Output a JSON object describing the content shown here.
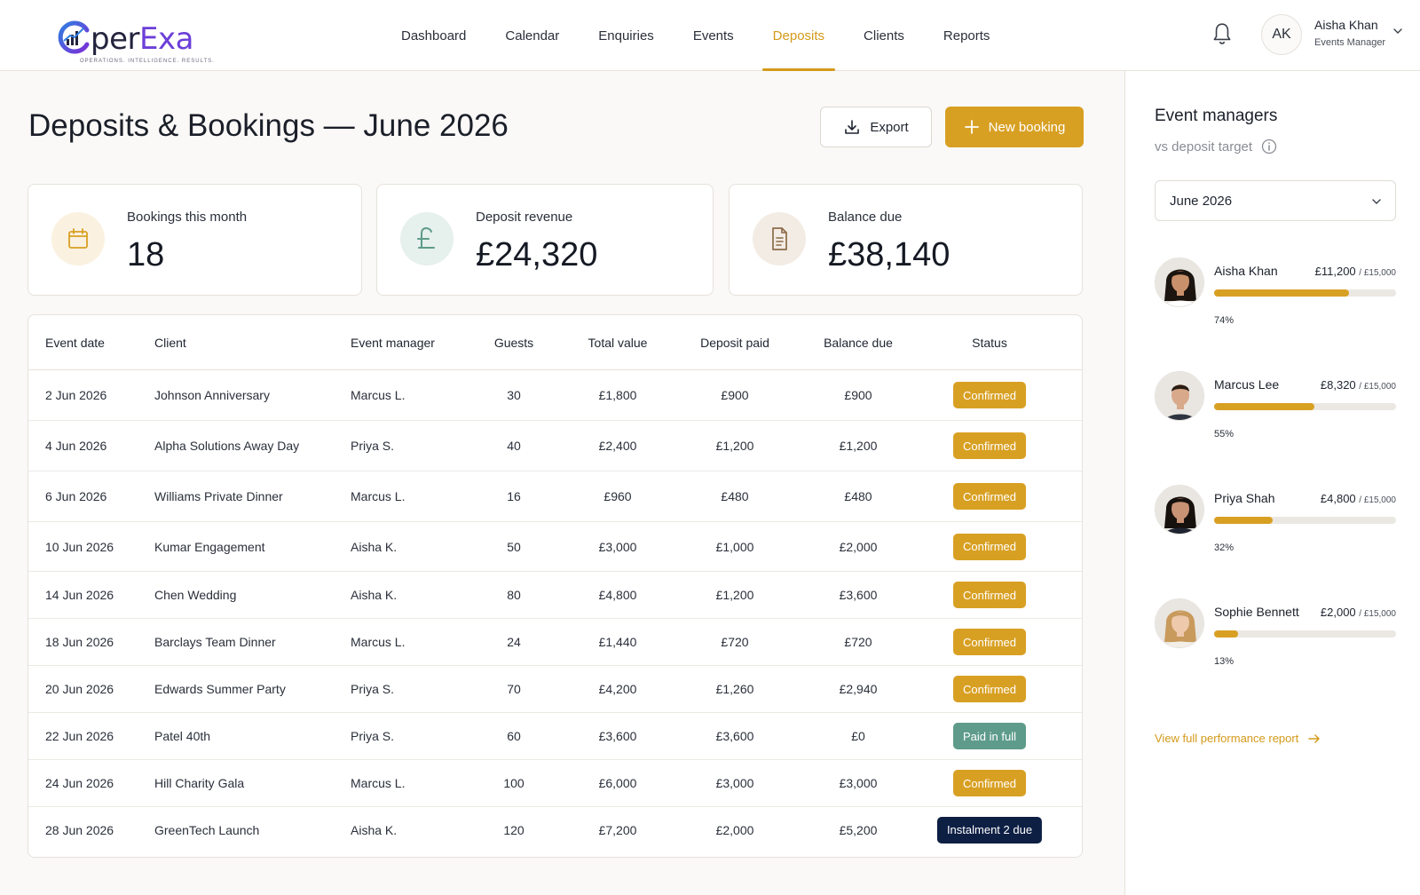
{
  "brand": {
    "name_prefix": "per",
    "name_suffix": "Exa",
    "tagline": "OPERATIONS. INTELLIGENCE. RESULTS.",
    "accent": "#6c3fd8"
  },
  "nav": {
    "items": [
      {
        "label": "Dashboard",
        "active": false
      },
      {
        "label": "Calendar",
        "active": false
      },
      {
        "label": "Enquiries",
        "active": false
      },
      {
        "label": "Events",
        "active": false
      },
      {
        "label": "Deposits",
        "active": true
      },
      {
        "label": "Clients",
        "active": false
      },
      {
        "label": "Reports",
        "active": false
      }
    ]
  },
  "user": {
    "initials": "AK",
    "name": "Aisha Khan",
    "role": "Events Manager"
  },
  "page": {
    "title": "Deposits & Bookings — June 2026",
    "export_label": "Export",
    "new_booking_label": "New booking"
  },
  "stats": [
    {
      "label": "Bookings this month",
      "value": "18",
      "icon": "calendar-icon"
    },
    {
      "label": "Deposit revenue",
      "value": "£24,320",
      "icon": "pound-icon"
    },
    {
      "label": "Balance due",
      "value": "£38,140",
      "icon": "document-icon"
    }
  ],
  "table": {
    "columns": [
      "Event date",
      "Client",
      "Event manager",
      "Guests",
      "Total value",
      "Deposit paid",
      "Balance due",
      "Status"
    ],
    "rows": [
      {
        "date": "2 Jun 2026",
        "client": "Johnson Anniversary",
        "manager": "Marcus L.",
        "guests": "30",
        "total": "£1,800",
        "deposit": "£900",
        "balance": "£900",
        "status": "Confirmed",
        "status_kind": "confirmed"
      },
      {
        "date": "4 Jun 2026",
        "client": "Alpha Solutions Away Day",
        "manager": "Priya S.",
        "guests": "40",
        "total": "£2,400",
        "deposit": "£1,200",
        "balance": "£1,200",
        "status": "Confirmed",
        "status_kind": "confirmed"
      },
      {
        "date": "6 Jun 2026",
        "client": "Williams Private Dinner",
        "manager": "Marcus L.",
        "guests": "16",
        "total": "£960",
        "deposit": "£480",
        "balance": "£480",
        "status": "Confirmed",
        "status_kind": "confirmed"
      },
      {
        "date": "10 Jun 2026",
        "client": "Kumar Engagement",
        "manager": "Aisha K.",
        "guests": "50",
        "total": "£3,000",
        "deposit": "£1,000",
        "balance": "£2,000",
        "status": "Confirmed",
        "status_kind": "confirmed"
      },
      {
        "date": "14 Jun 2026",
        "client": "Chen Wedding",
        "manager": "Aisha K.",
        "guests": "80",
        "total": "£4,800",
        "deposit": "£1,200",
        "balance": "£3,600",
        "status": "Confirmed",
        "status_kind": "confirmed"
      },
      {
        "date": "18 Jun 2026",
        "client": "Barclays Team Dinner",
        "manager": "Marcus L.",
        "guests": "24",
        "total": "£1,440",
        "deposit": "£720",
        "balance": "£720",
        "status": "Confirmed",
        "status_kind": "confirmed"
      },
      {
        "date": "20 Jun 2026",
        "client": "Edwards Summer Party",
        "manager": "Priya S.",
        "guests": "70",
        "total": "£4,200",
        "deposit": "£1,260",
        "balance": "£2,940",
        "status": "Confirmed",
        "status_kind": "confirmed"
      },
      {
        "date": "22 Jun 2026",
        "client": "Patel 40th",
        "manager": "Priya S.",
        "guests": "60",
        "total": "£3,600",
        "deposit": "£3,600",
        "balance": "£0",
        "status": "Paid in full",
        "status_kind": "paid"
      },
      {
        "date": "24 Jun 2026",
        "client": "Hill Charity Gala",
        "manager": "Marcus L.",
        "guests": "100",
        "total": "£6,000",
        "deposit": "£3,000",
        "balance": "£3,000",
        "status": "Confirmed",
        "status_kind": "confirmed"
      },
      {
        "date": "28 Jun 2026",
        "client": "GreenTech Launch",
        "manager": "Aisha K.",
        "guests": "120",
        "total": "£7,200",
        "deposit": "£2,000",
        "balance": "£5,200",
        "status": "Instalment 2 due",
        "status_kind": "instal"
      }
    ]
  },
  "sidebar": {
    "title": "Event managers",
    "subtitle": "vs deposit target",
    "period": "June 2026",
    "managers": [
      {
        "name": "Aisha Khan",
        "amount": "£11,200",
        "target": "/ £15,000",
        "pct_label": "74%",
        "progress": 0.74
      },
      {
        "name": "Marcus Lee",
        "amount": "£8,320",
        "target": "/ £15,000",
        "pct_label": "55%",
        "progress": 0.55
      },
      {
        "name": "Priya Shah",
        "amount": "£4,800",
        "target": "/ £15,000",
        "pct_label": "32%",
        "progress": 0.32
      },
      {
        "name": "Sophie Bennett",
        "amount": "£2,000",
        "target": "/ £15,000",
        "pct_label": "13%",
        "progress": 0.13
      }
    ],
    "link_label": "View full performance report"
  },
  "colors": {
    "gold": "#d8a023",
    "teal": "#5e9b8a",
    "navy": "#0e1f44"
  }
}
